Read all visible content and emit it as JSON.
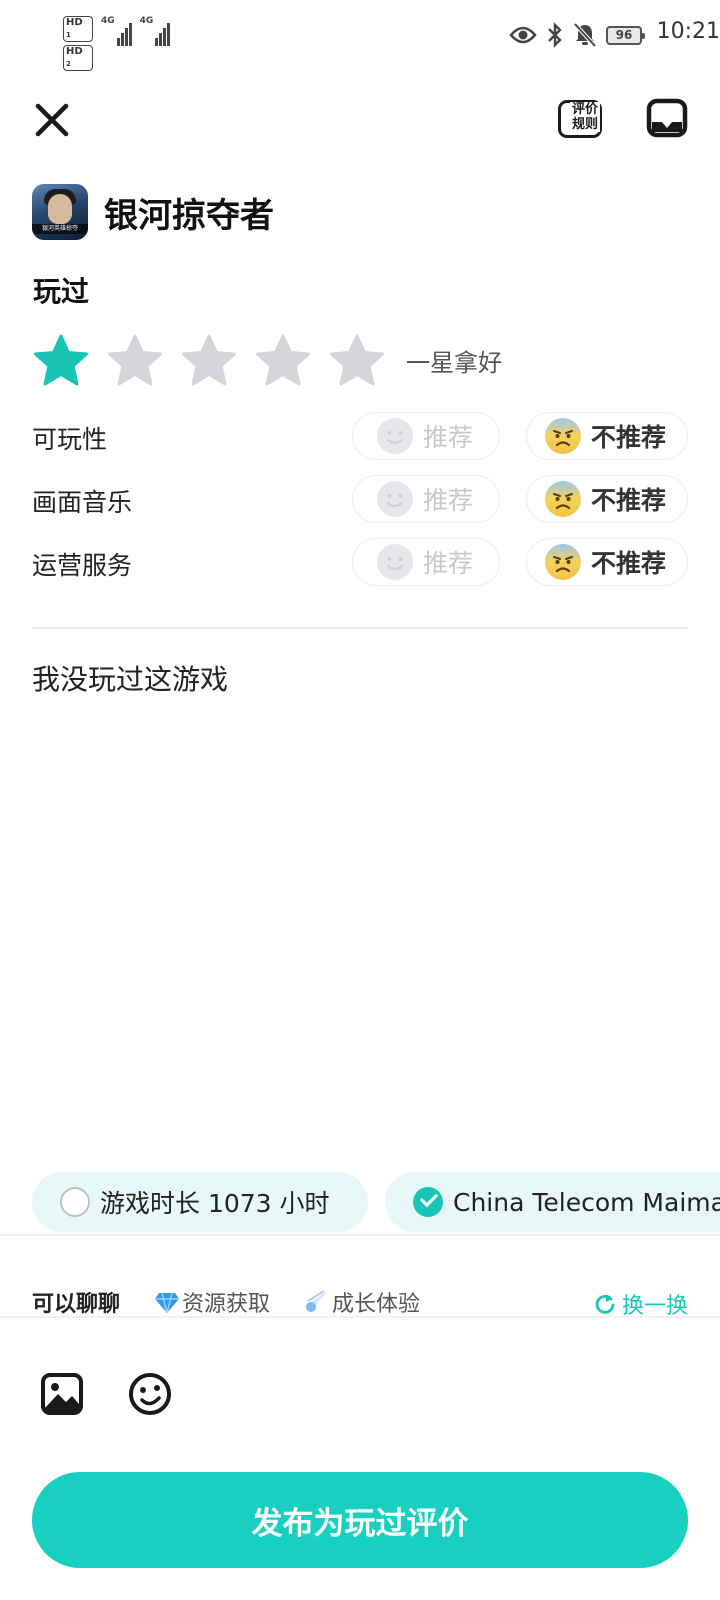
{
  "status_bar": {
    "sim1": "HD",
    "sim1_index": "1",
    "sim2": "HD",
    "sim2_index": "2",
    "net1": "4G",
    "net2": "4G",
    "battery": "96",
    "time": "10:21",
    "icons": [
      "eye-icon",
      "bluetooth-icon",
      "bell-off-icon"
    ]
  },
  "top_bar": {
    "rules_label": "评价规则",
    "icons": [
      "close-icon",
      "rules-icon",
      "chat-icon"
    ]
  },
  "app": {
    "name": "银河掠夺者",
    "icon_banner": "银河英雄掠夺"
  },
  "review": {
    "status": "玩过",
    "rating": 1,
    "max_rating": 5,
    "rating_text": "一星拿好",
    "accent_color": "#19c5b6",
    "aspects": [
      {
        "label": "可玩性",
        "recommend": "推荐",
        "not_recommend": "不推荐",
        "selected": "not_recommend"
      },
      {
        "label": "画面音乐",
        "recommend": "推荐",
        "not_recommend": "不推荐",
        "selected": "not_recommend"
      },
      {
        "label": "运营服务",
        "recommend": "推荐",
        "not_recommend": "不推荐",
        "selected": "not_recommend"
      }
    ],
    "text": "我没玩过这游戏"
  },
  "tags": [
    {
      "label": "游戏时长 1073 小时",
      "checked": false
    },
    {
      "label": "China Telecom Maimang",
      "checked": true
    }
  ],
  "topics": {
    "label": "可以聊聊",
    "items": [
      {
        "label": "资源获取",
        "icon": "diamond-icon"
      },
      {
        "label": "成长体验",
        "icon": "comet-icon"
      }
    ],
    "refresh": "换一换"
  },
  "toolbar": {
    "icons": [
      "image-icon",
      "emoji-icon"
    ]
  },
  "publish_label": "发布为玩过评价"
}
